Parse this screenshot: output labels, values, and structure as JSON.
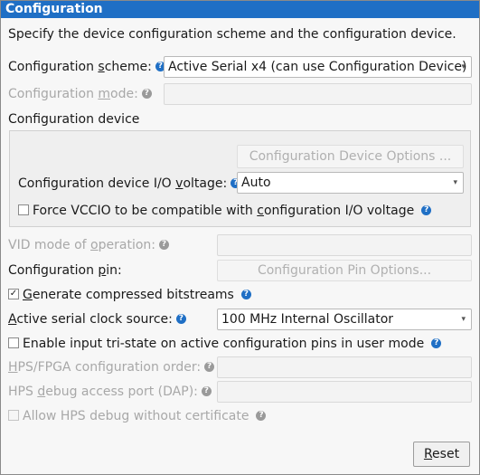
{
  "title": "Configuration",
  "description": "Specify the device configuration scheme and the configuration device.",
  "scheme": {
    "label_pre": "Configuration ",
    "label_u": "s",
    "label_post": "cheme:",
    "value": "Active Serial x4 (can use Configuration Device)"
  },
  "mode": {
    "label_pre": "Configuration ",
    "label_u": "m",
    "label_post": "ode:",
    "value": ""
  },
  "device_section": {
    "heading": "Configuration device",
    "options_button": "Configuration Device Options ...",
    "io_voltage": {
      "label_pre": "Configuration device I/O ",
      "label_u": "v",
      "label_post": "oltage:",
      "value": "Auto"
    },
    "force_vccio": {
      "label_pre": "Force VCCIO to be compatible with ",
      "label_u": "c",
      "label_post": "onfiguration I/O voltage",
      "checked": false
    }
  },
  "vid_mode": {
    "label_pre": "VID mode of ",
    "label_u": "o",
    "label_post": "peration:",
    "value": ""
  },
  "config_pin": {
    "label_pre": "Configuration ",
    "label_u": "p",
    "label_post": "in:",
    "button": "Configuration Pin Options..."
  },
  "compressed": {
    "label_u": "G",
    "label_post": "enerate compressed bitstreams",
    "checked": true
  },
  "clock_source": {
    "label_u": "A",
    "label_post": "ctive serial clock source:",
    "value": "100 MHz Internal Oscillator"
  },
  "tristate": {
    "label": "Enable input tri-state on active configuration pins in user mode",
    "checked": false
  },
  "hps_order": {
    "label_u": "H",
    "label_post": "PS/FPGA configuration order:",
    "value": ""
  },
  "hps_dap": {
    "label_pre": "HPS ",
    "label_u": "d",
    "label_post": "ebug access port (DAP):",
    "value": ""
  },
  "hps_cert": {
    "label": "Allow HPS debug without certificate",
    "checked": false
  },
  "reset_button": {
    "label_u": "R",
    "label_post": "eset"
  },
  "help_glyph": "?",
  "check_glyph": "✓",
  "dropdown_glyph": "▾",
  "colors": {
    "accent": "#1f6fc5",
    "panel_bg": "#f7f7f7",
    "disabled_text": "#a8a8a8"
  }
}
